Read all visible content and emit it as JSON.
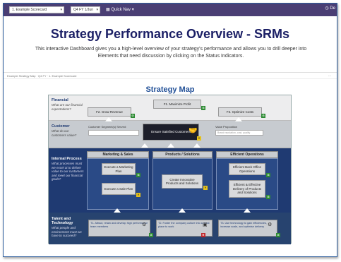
{
  "topbar": {
    "scorecard_select": "1. Example Scorecard",
    "period_select": "Q4 FY 1/Jun",
    "quick_nav": "Quick Nav",
    "right_fragment": "De"
  },
  "header": {
    "title": "Strategy Performance Overview - SRMs",
    "description": "This interactive Dashboard gives you a high-level overview of your strategy's performance and allows you to drill deeper into Elements that need discussion by clicking on the Status Indicators."
  },
  "breadcrumb": {
    "text": "Example Strategy Map  ·  Q4 FY  ·  1. Example Scorecard",
    "more": "..."
  },
  "strategy_map": {
    "title": "Strategy Map",
    "perspectives": {
      "financial": {
        "heading": "Financial",
        "question": "What are our financial expectations?"
      },
      "customer": {
        "heading": "Customer",
        "question": "What do our customers value?"
      },
      "internal": {
        "heading": "Internal Process",
        "question": "What processes must we excel at to deliver value to our customers and meet our financial goals?"
      },
      "talent": {
        "heading": "Talent and Technology",
        "question": "What people and environment must we have to succeed?"
      }
    },
    "financial_objectives": [
      {
        "label": "F2. Grow Revenue",
        "status": "G"
      },
      {
        "label": "F1. Maximize Profit",
        "status": "G"
      },
      {
        "label": "F3. Optimize Costs",
        "status": "G"
      }
    ],
    "customer": {
      "segments_label": "Customer Segment(s) Served:",
      "value_prop_label": "Value Proposition",
      "value_prop_placeholder": "Brand reputation, cost, quality",
      "center_objective": {
        "label": "Ensure Satisfied Customers",
        "status": "Y"
      }
    },
    "internal_columns": [
      {
        "heading": "Marketing & Sales",
        "objectives": [
          {
            "label": "Execute a Marketing Plan",
            "status": "G"
          },
          {
            "label": "Execute a Sale Plan",
            "status": "Y"
          }
        ]
      },
      {
        "heading": "Products / Solutions",
        "objectives": [
          {
            "label": "Create Innovative Products and Solutions",
            "status": "Y"
          }
        ]
      },
      {
        "heading": "Efficient Operations",
        "objectives": [
          {
            "label": "Efficient Back Office Operations",
            "status": "G"
          },
          {
            "label": "Efficient & Effective Delivery of Products and Solutions",
            "status": "G"
          }
        ]
      }
    ],
    "talent_objectives": [
      {
        "label": "T1. Attract, retain and develop high performance team members",
        "status": "G"
      },
      {
        "label": "T2. Foster the company culture into a great place to work",
        "status": "R"
      },
      {
        "label": "T3. Use technology to gain efficiencies, increase scale, and optimise delivery",
        "status": "G"
      }
    ]
  },
  "colors": {
    "topbar": "#4a3e74",
    "title": "#1c2066",
    "internal_band": "#1f3a72",
    "status_green": "#2e8b34",
    "status_yellow": "#e6c21a",
    "status_red": "#c0282d"
  }
}
